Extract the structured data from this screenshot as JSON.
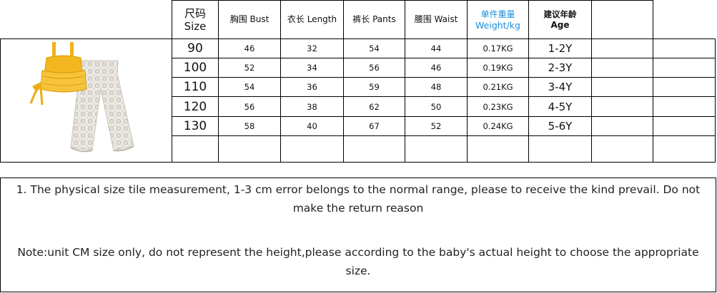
{
  "headers": {
    "size_cn": "尺码",
    "size_en": "Size",
    "bust": "胸围 Bust",
    "length": "衣长 Length",
    "pants": "裤长 Pants",
    "waist": "腰围 Waist",
    "weight_cn": "单件重量",
    "weight_en": "Weight/kg",
    "age_cn": "建议年龄",
    "age_en": "Age"
  },
  "rows": [
    {
      "size": "90",
      "bust": "46",
      "length": "32",
      "pants": "54",
      "waist": "44",
      "weight": "0.17KG",
      "age": "1-2Y"
    },
    {
      "size": "100",
      "bust": "52",
      "length": "34",
      "pants": "56",
      "waist": "46",
      "weight": "0.19KG",
      "age": "2-3Y"
    },
    {
      "size": "110",
      "bust": "54",
      "length": "36",
      "pants": "59",
      "waist": "48",
      "weight": "0.21KG",
      "age": "3-4Y"
    },
    {
      "size": "120",
      "bust": "56",
      "length": "38",
      "pants": "62",
      "waist": "50",
      "weight": "0.23KG",
      "age": "4-5Y"
    },
    {
      "size": "130",
      "bust": "58",
      "length": "40",
      "pants": "67",
      "waist": "52",
      "weight": "0.24KG",
      "age": "5-6Y"
    }
  ],
  "notes": {
    "note1": "1. The physical size tile measurement, 1-3 cm error belongs to the normal range, please to receive the kind prevail. Do not make the return reason",
    "note2": "Note:unit CM size only, do not represent the height,please according to the baby's actual height to choose the appropriate size."
  },
  "colors": {
    "weight_header": "#1a8fe0",
    "top_yellow": "#f3b51c",
    "pants_lace": "#e9e6e0"
  },
  "image": {
    "icon": "product-outfit-image"
  }
}
